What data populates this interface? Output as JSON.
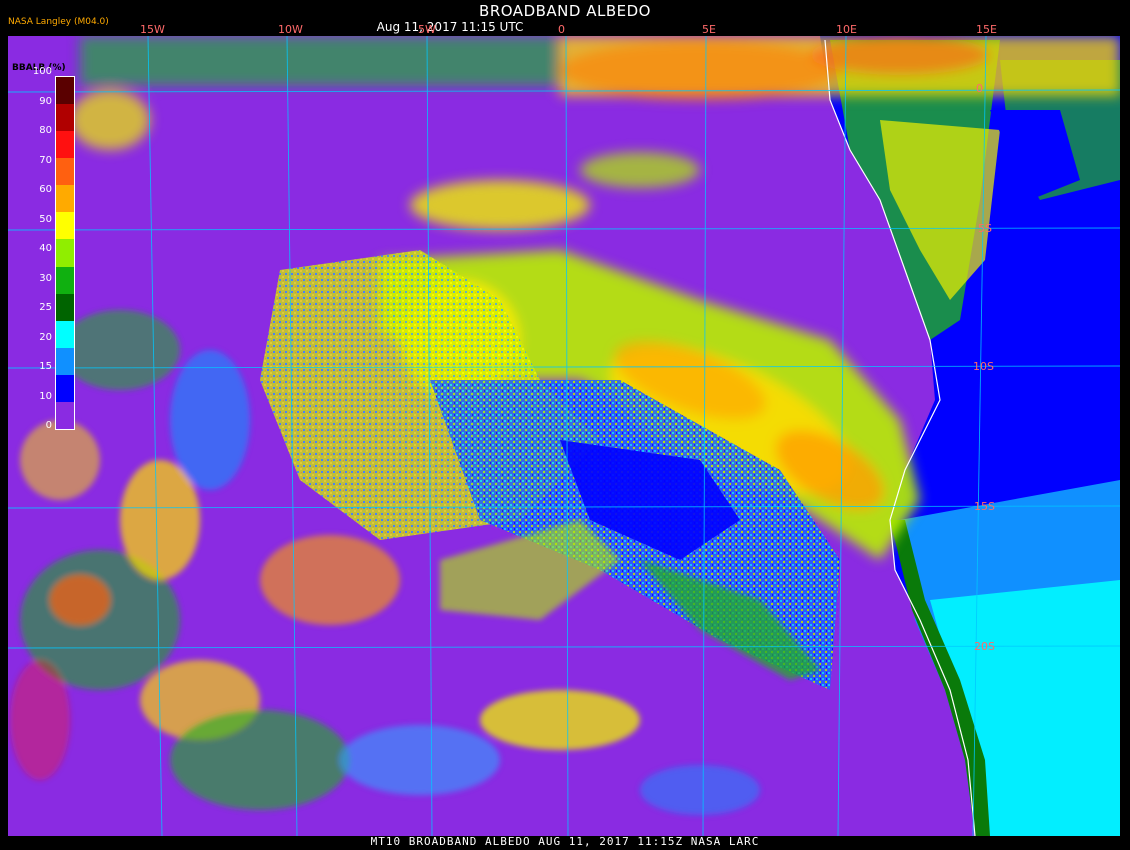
{
  "header": {
    "title": "BROADBAND ALBEDO",
    "subtitle": "Aug 11, 2017 11:15 UTC",
    "provider": "NASA Langley (M04.0)"
  },
  "footer": {
    "caption": "MT10  BROADBAND ALBEDO   AUG 11, 2017 11:15Z   NASA LARC"
  },
  "longitude_labels": [
    "15W",
    "10W",
    "5W",
    "0",
    "5E",
    "10E",
    "15E"
  ],
  "latitude_labels": [
    "0",
    "5S",
    "10S",
    "15S",
    "20S"
  ],
  "legend": {
    "title": "BBALB (%)",
    "ticks": [
      "100",
      "90",
      "80",
      "70",
      "60",
      "50",
      "40",
      "30",
      "25",
      "20",
      "15",
      "10",
      "0"
    ],
    "colors": [
      "#5a0000",
      "#b00000",
      "#ff1010",
      "#ff6010",
      "#ffaa00",
      "#ffff00",
      "#90ee00",
      "#10b010",
      "#006400",
      "#00ffff",
      "#1090ff",
      "#0000ff",
      "#8a2be2"
    ]
  },
  "colors": {
    "clear_ocean": "#8a2be2",
    "land_green": "#0a6a0a",
    "grid": "#00c8ff"
  }
}
